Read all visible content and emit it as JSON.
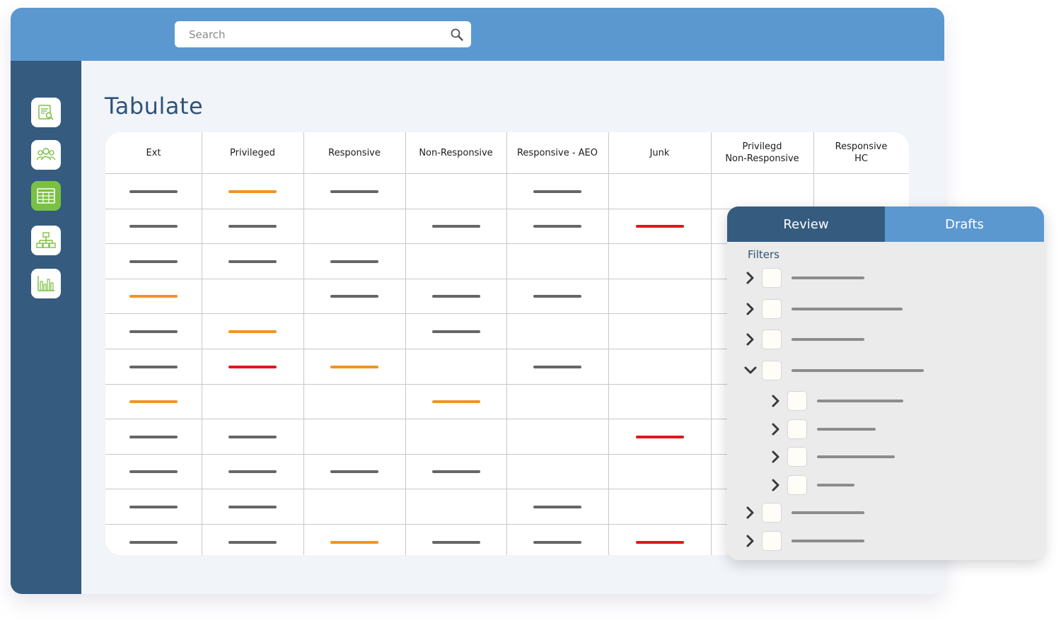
{
  "search": {
    "placeholder": "Search",
    "icon": "search-icon"
  },
  "sidebar": {
    "items": [
      {
        "name": "document-search",
        "icon": "document-search-icon",
        "active": false
      },
      {
        "name": "users",
        "icon": "users-icon",
        "active": false
      },
      {
        "name": "tabulate",
        "icon": "table-icon",
        "active": true
      },
      {
        "name": "hierarchy",
        "icon": "hierarchy-icon",
        "active": false
      },
      {
        "name": "analytics",
        "icon": "bar-chart-icon",
        "active": false
      }
    ]
  },
  "page": {
    "title": "Tabulate"
  },
  "colors": {
    "gray": "#666666",
    "orange": "#f29322",
    "red": "#e0171f",
    "accent_dark": "#355b7f",
    "accent_light": "#5b98cf",
    "active_green": "#7ac143"
  },
  "table": {
    "columns": [
      {
        "key": "ext",
        "lines": [
          "Ext"
        ]
      },
      {
        "key": "privileged",
        "lines": [
          "Privileged"
        ]
      },
      {
        "key": "responsive",
        "lines": [
          "Responsive"
        ]
      },
      {
        "key": "non_responsive",
        "lines": [
          "Non-Responsive"
        ]
      },
      {
        "key": "responsive_aeo",
        "lines": [
          "Responsive - AEO"
        ]
      },
      {
        "key": "junk",
        "lines": [
          "Junk"
        ]
      },
      {
        "key": "privilegd_non_responsive",
        "lines": [
          "Privilegd",
          "Non-Responsive"
        ]
      },
      {
        "key": "responsive_hc",
        "lines": [
          "Responsive",
          "HC"
        ]
      }
    ],
    "rows": [
      [
        "gray",
        "orange",
        "gray",
        null,
        "gray",
        null,
        null,
        null
      ],
      [
        "gray",
        "gray",
        null,
        "gray",
        "gray",
        "red",
        null,
        null
      ],
      [
        "gray",
        "gray",
        "gray",
        null,
        null,
        null,
        null,
        null
      ],
      [
        "orange",
        null,
        "gray",
        "gray",
        "gray",
        null,
        null,
        null
      ],
      [
        "gray",
        "orange",
        null,
        "gray",
        null,
        null,
        null,
        null
      ],
      [
        "gray",
        "red",
        "orange",
        null,
        "gray",
        null,
        null,
        null
      ],
      [
        "orange",
        null,
        null,
        "orange",
        null,
        null,
        null,
        null
      ],
      [
        "gray",
        "gray",
        null,
        null,
        null,
        "red",
        null,
        null
      ],
      [
        "gray",
        "gray",
        "gray",
        "gray",
        null,
        null,
        null,
        null
      ],
      [
        "gray",
        "gray",
        null,
        null,
        "gray",
        null,
        null,
        null
      ],
      [
        "gray",
        "gray",
        "orange",
        "gray",
        "gray",
        "red",
        null,
        null
      ]
    ]
  },
  "panel": {
    "tabs": [
      {
        "label": "Review",
        "active": true
      },
      {
        "label": "Drafts",
        "active": false
      }
    ],
    "filters_label": "Filters",
    "filters": [
      {
        "level": 0,
        "expanded": false,
        "fill": 0.55
      },
      {
        "level": 0,
        "expanded": false,
        "fill": 0.84
      },
      {
        "level": 0,
        "expanded": false,
        "fill": 0.55
      },
      {
        "level": 0,
        "expanded": true,
        "fill": 1.0
      },
      {
        "level": 1,
        "expanded": false,
        "fill": 0.81
      },
      {
        "level": 1,
        "expanded": false,
        "fill": 0.55
      },
      {
        "level": 1,
        "expanded": false,
        "fill": 0.73
      },
      {
        "level": 1,
        "expanded": false,
        "fill": 0.35
      },
      {
        "level": 0,
        "expanded": false,
        "fill": 0.55
      },
      {
        "level": 0,
        "expanded": false,
        "fill": 0.55
      }
    ]
  }
}
